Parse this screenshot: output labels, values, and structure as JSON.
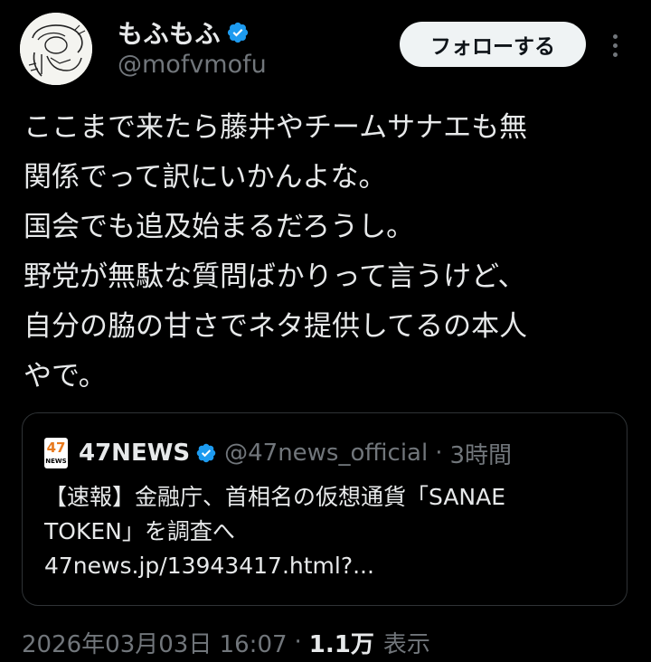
{
  "author": {
    "display_name": "もふもふ",
    "handle": "@mofvmofu",
    "verified": true,
    "verified_color": "#1d9bf0"
  },
  "actions": {
    "follow_label": "フォローする",
    "more_icon": "more-vertical-icon"
  },
  "tweet": {
    "text": "ここまで来たら藤井やチームサナエも無\n関係でって訳にいかんよな。\n国会でも追及始まるだろうし。\n野党が無駄な質問ばかりって言うけど、\n自分の脇の甘さでネタ提供してるの本人\nやで。"
  },
  "quote": {
    "logo_number": "47",
    "logo_text": "NEWS",
    "name": "47NEWS",
    "verified": true,
    "handle": "@47news_official",
    "separator": "·",
    "time": "3時間",
    "body": "【速報】金融庁、首相名の仮想通貨「SANAE\nTOKEN」を調査へ\n47news.jp/13943417.html?..."
  },
  "meta": {
    "timestamp": "2026年03月03日 16:07",
    "separator": "·",
    "views_count": "1.1万",
    "views_label": "表示"
  },
  "colors": {
    "background": "#000000",
    "text": "#e7e9ea",
    "muted": "#71767b",
    "border": "#2f3336",
    "accent": "#1d9bf0"
  }
}
